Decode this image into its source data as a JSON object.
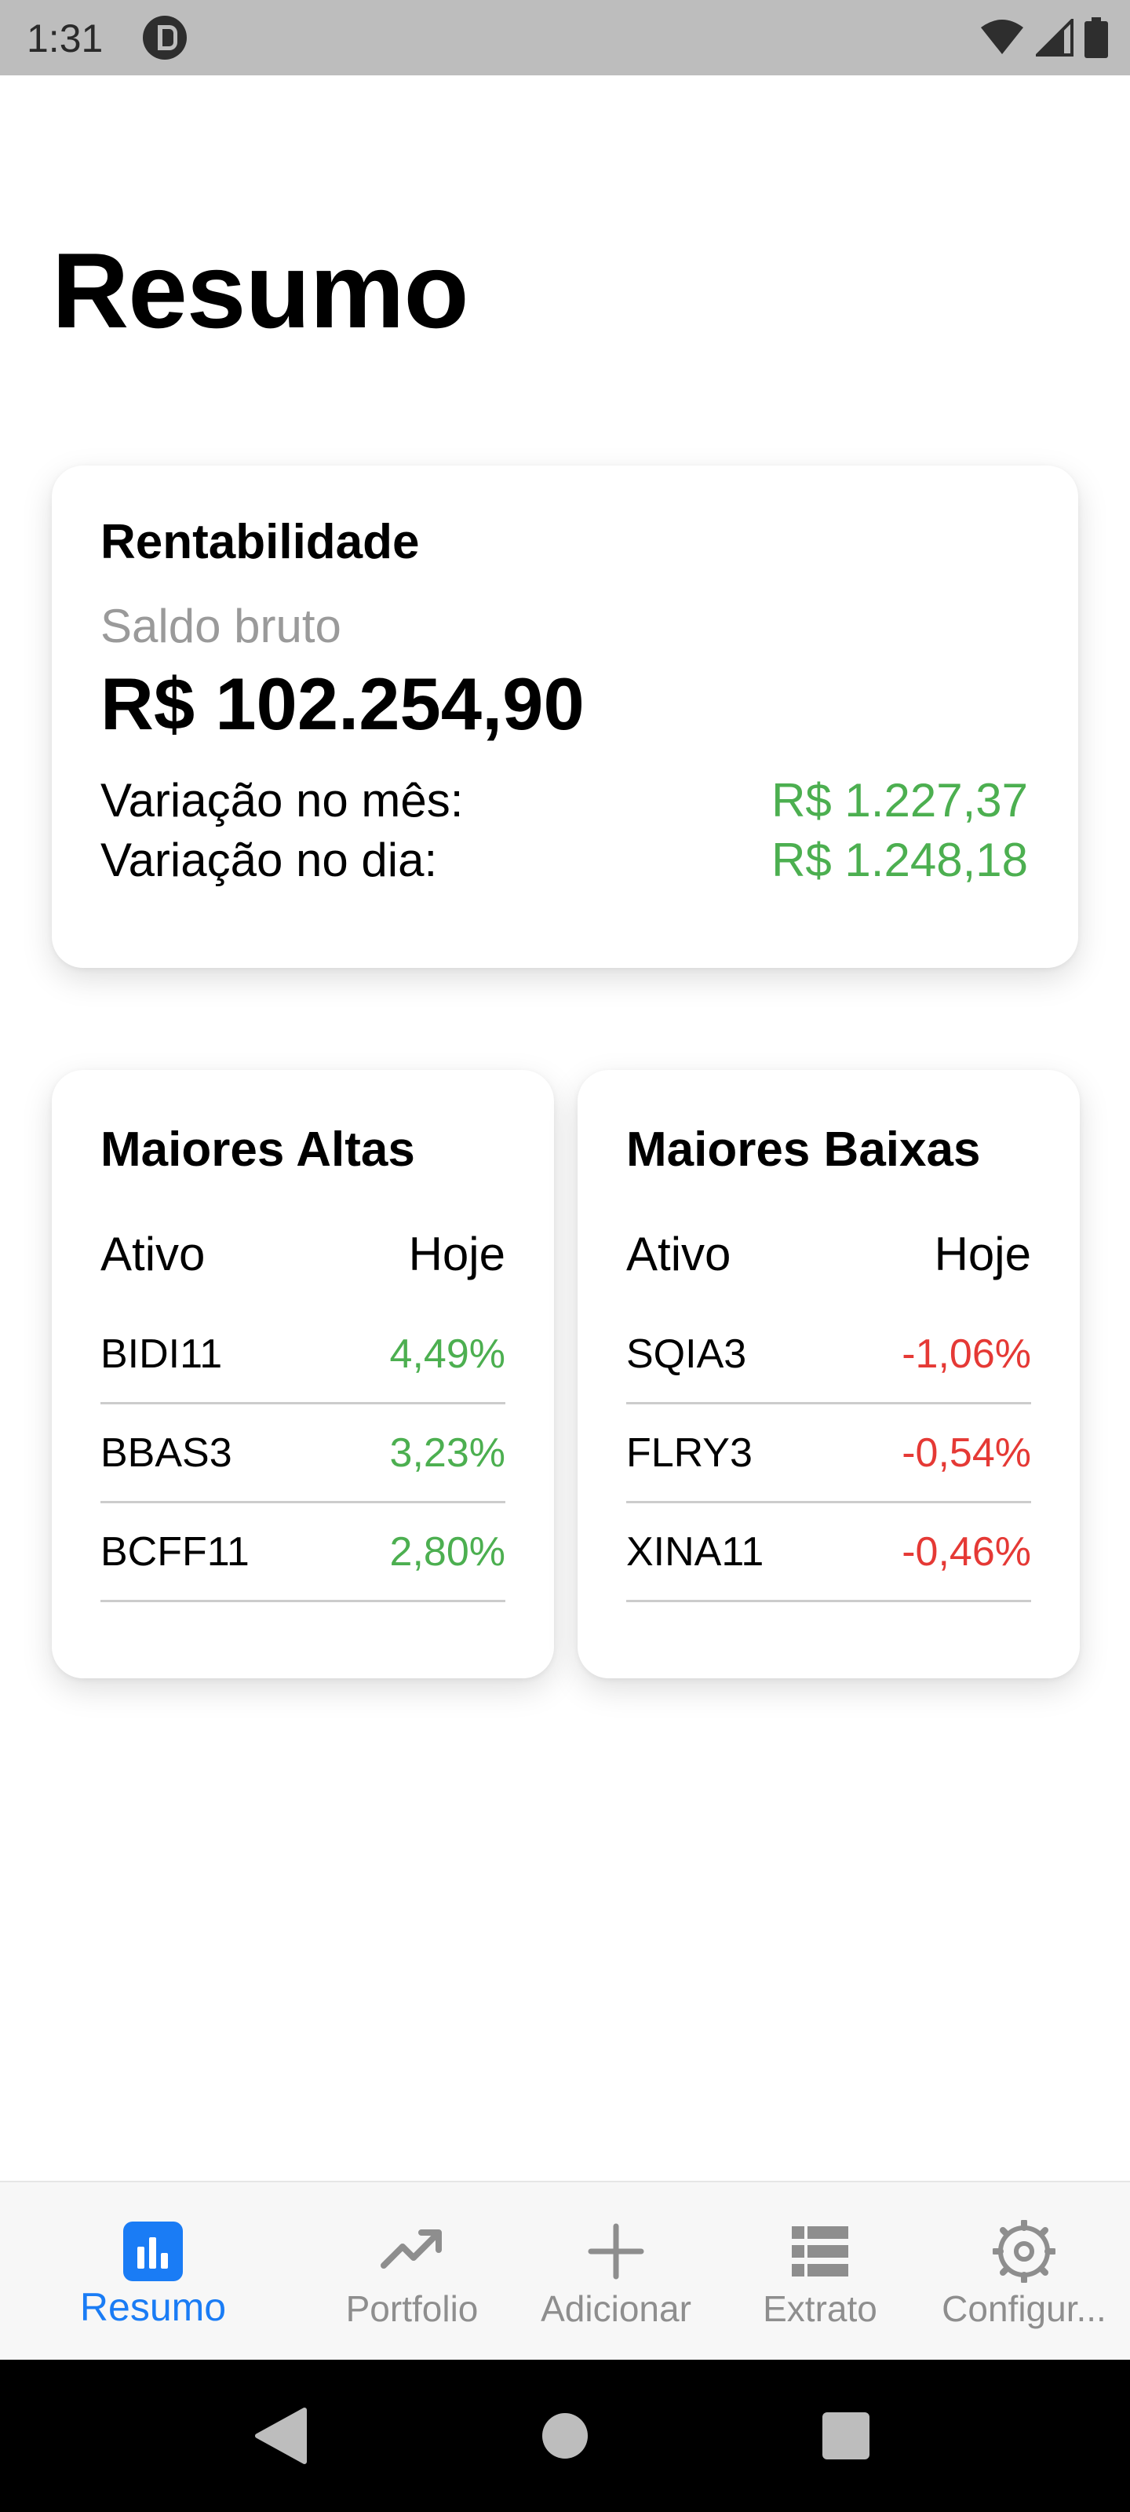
{
  "status_bar": {
    "time": "1:31"
  },
  "page": {
    "title": "Resumo"
  },
  "rentabilidade": {
    "title": "Rentabilidade",
    "saldo_label": "Saldo bruto",
    "saldo_value": "R$ 102.254,90",
    "variacao_mes_label": "Variação no mês:",
    "variacao_mes_value": "R$ 1.227,37",
    "variacao_dia_label": "Variação no dia:",
    "variacao_dia_value": "R$ 1.248,18"
  },
  "maiores_altas": {
    "title": "Maiores Altas",
    "col_asset": "Ativo",
    "col_today": "Hoje",
    "rows": [
      {
        "asset": "BIDI11",
        "change": "4,49%"
      },
      {
        "asset": "BBAS3",
        "change": "3,23%"
      },
      {
        "asset": "BCFF11",
        "change": "2,80%"
      }
    ]
  },
  "maiores_baixas": {
    "title": "Maiores Baixas",
    "col_asset": "Ativo",
    "col_today": "Hoje",
    "rows": [
      {
        "asset": "SQIA3",
        "change": "-1,06%"
      },
      {
        "asset": "FLRY3",
        "change": "-0,54%"
      },
      {
        "asset": "XINA11",
        "change": "-0,46%"
      }
    ]
  },
  "bottom_nav": {
    "items": [
      {
        "label": "Resumo",
        "icon": "bar-chart-icon",
        "active": true
      },
      {
        "label": "Portfolio",
        "icon": "trending-up-icon"
      },
      {
        "label": "Adicionar",
        "icon": "plus-icon"
      },
      {
        "label": "Extrato",
        "icon": "list-icon"
      },
      {
        "label": "Configur...",
        "icon": "gear-icon"
      }
    ]
  },
  "colors": {
    "positive": "#4caf50",
    "negative": "#e53935",
    "accent": "#1a7cf5"
  }
}
